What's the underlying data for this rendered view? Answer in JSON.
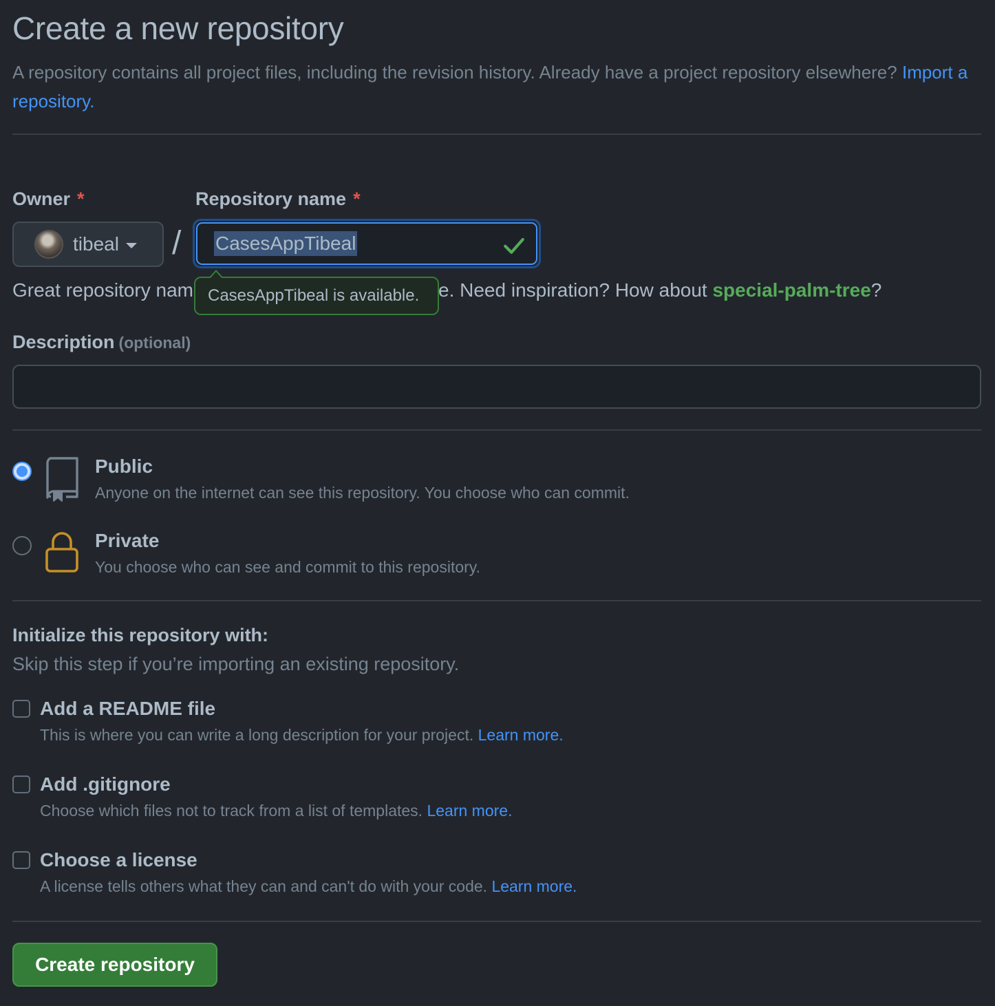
{
  "header": {
    "title": "Create a new repository",
    "subtitle_prefix": "A repository contains all project files, including the revision history. Already have a project repository elsewhere?",
    "import_link": "Import a repository."
  },
  "owner": {
    "label": "Owner",
    "required_mark": "*",
    "name": "tibeal"
  },
  "slash": "/",
  "repository_name": {
    "label": "Repository name",
    "required_mark": "*",
    "value": "CasesAppTibeal"
  },
  "availability_tooltip": "CasesAppTibeal is available.",
  "name_hint": {
    "prefix": "Great repository nam",
    "middle": "e. Need inspiration? How about ",
    "suggestion": "special-palm-tree",
    "suffix": "?"
  },
  "description": {
    "label": "Description",
    "optional": "(optional)",
    "value": ""
  },
  "visibility": {
    "public": {
      "title": "Public",
      "description": "Anyone on the internet can see this repository. You choose who can commit.",
      "selected": true
    },
    "private": {
      "title": "Private",
      "description": "You choose who can see and commit to this repository.",
      "selected": false
    }
  },
  "initialize": {
    "title": "Initialize this repository with:",
    "subtitle": "Skip this step if you’re importing an existing repository.",
    "options": [
      {
        "title": "Add a README file",
        "description": "This is where you can write a long description for your project.",
        "link": "Learn more.",
        "checked": false
      },
      {
        "title": "Add .gitignore",
        "description": "Choose which files not to track from a list of templates.",
        "link": "Learn more.",
        "checked": false
      },
      {
        "title": "Choose a license",
        "description": "A license tells others what they can and can't do with your code.",
        "link": "Learn more.",
        "checked": false
      }
    ]
  },
  "submit_label": "Create repository",
  "colors": {
    "background": "#22262c",
    "accent_blue": "#4493f8",
    "success_green": "#347d39",
    "suggest_green": "#57ab5a",
    "lock_orange": "#c69026",
    "required_red": "#e5534b"
  },
  "icons": {
    "public": "repo-icon",
    "private": "lock-icon",
    "available": "check-icon",
    "owner_dropdown": "caret-down-icon"
  }
}
